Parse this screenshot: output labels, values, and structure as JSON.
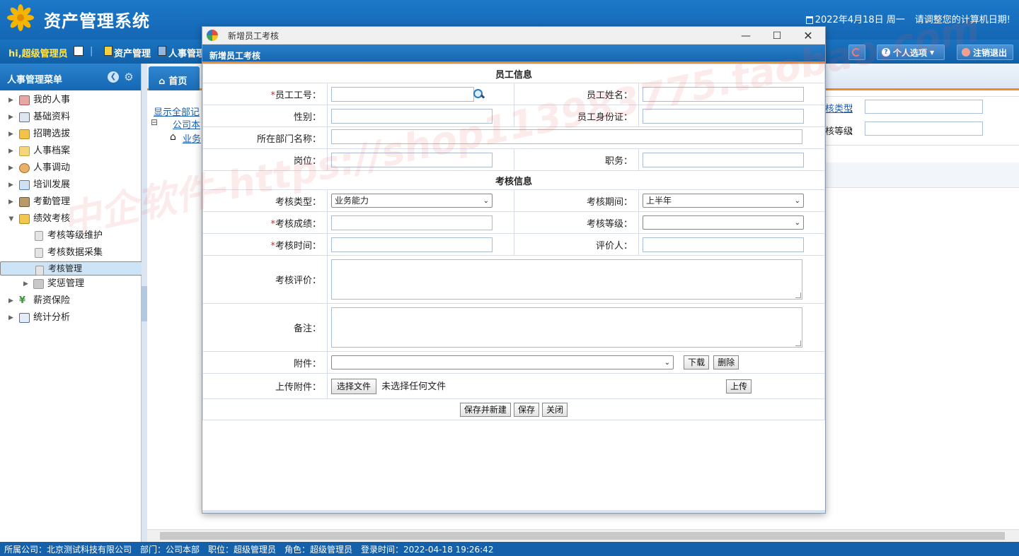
{
  "app": {
    "title": "资产管理系统",
    "date_text": "2022年4月18日 周一",
    "date_hint": "请调整您的计算机日期!"
  },
  "navbar": {
    "greeting": "hi,超级管理员",
    "items": [
      "资产管理",
      "人事管理"
    ],
    "personal_options": "个人选项",
    "logout": "注销退出"
  },
  "sidebar": {
    "title": "人事管理菜单",
    "items": [
      {
        "label": "我的人事",
        "icon": "user-card-icon",
        "color": "#d9534f"
      },
      {
        "label": "基础资料",
        "icon": "grid-icon",
        "color": "#5a6f8c"
      },
      {
        "label": "招聘选拔",
        "icon": "speaker-icon",
        "color": "#e0a020"
      },
      {
        "label": "人事档案",
        "icon": "folder-icon",
        "color": "#e8c050"
      },
      {
        "label": "人事调动",
        "icon": "users-icon",
        "color": "#d08a2a"
      },
      {
        "label": "培训发展",
        "icon": "monitor-icon",
        "color": "#4a7fb8"
      },
      {
        "label": "考勤管理",
        "icon": "clock-icon",
        "color": "#6b5a3c"
      },
      {
        "label": "绩效考核",
        "icon": "signpost-icon",
        "color": "#d7a62a"
      }
    ],
    "sub_items": [
      {
        "label": "考核等级维护"
      },
      {
        "label": "考核数据采集"
      },
      {
        "label": "考核管理"
      },
      {
        "label": "奖惩管理"
      }
    ],
    "tail_items": [
      {
        "label": "薪资保险",
        "icon": "yen-icon",
        "color": "#3a9a3a"
      },
      {
        "label": "统计分析",
        "icon": "chart-icon",
        "color": "#4a6ea0"
      }
    ]
  },
  "main": {
    "tab_home": "首页",
    "show_all": "显示全部记",
    "company": "公司本",
    "business": "业务",
    "bg_label_type": "核类型",
    "bg_label_level": "核等级",
    "colon": "："
  },
  "dialog": {
    "window_title": "新增员工考核",
    "header": "新增员工考核",
    "section_employee": "员工信息",
    "section_assessment": "考核信息",
    "labels": {
      "emp_no": "员工工号：",
      "emp_name": "员工姓名：",
      "gender": "性别：",
      "id_card": "员工身份证：",
      "dept": "所在部门名称：",
      "post": "岗位：",
      "duty": "职务：",
      "assess_type": "考核类型：",
      "assess_period": "考核期间：",
      "assess_score": "考核成绩：",
      "assess_level": "考核等级：",
      "assess_time": "考核时间：",
      "reviewer": "评价人：",
      "assess_comment": "考核评价：",
      "remark": "备注：",
      "attachment": "附件：",
      "upload_attachment": "上传附件："
    },
    "required_mark": "*",
    "values": {
      "assess_type": "业务能力",
      "assess_period": "上半年",
      "assess_level": "",
      "attachment": ""
    },
    "buttons": {
      "download": "下载",
      "delete": "删除",
      "choose_file": "选择文件",
      "no_file": "未选择任何文件",
      "upload": "上传",
      "save_and_new": "保存并新建",
      "save": "保存",
      "close": "关闭"
    }
  },
  "statusbar": {
    "text": "所属公司：北京测试科技有限公司　部门：公司本部　职位：超级管理员　角色：超级管理员　登录时间：2022-04-18 19:26:42"
  },
  "watermark": "中企软件-https://shop113983775.taobao.com"
}
